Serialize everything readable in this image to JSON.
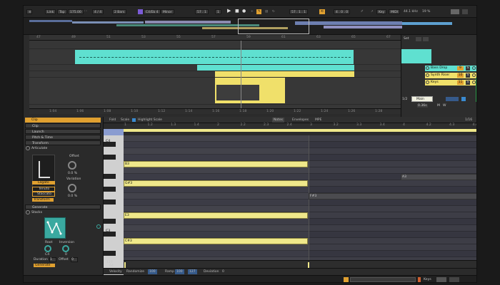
{
  "transport": {
    "link": "Link",
    "tap": "Tap",
    "tempo": "175.00",
    "signature": "4 / 4",
    "quantize": "2 Bars",
    "key": "C4/Eb 4",
    "scale": "Minor",
    "position": "57 . 1",
    "position2": "1",
    "loop_start": "57 . 1 . 1",
    "loop_len": "4 . 0 . 0",
    "key_label": "Key",
    "midi_label": "MIDI",
    "sample_rate": "44.1 kHz",
    "cpu": "19 %"
  },
  "ruler_top": [
    "47",
    "49",
    "51",
    "53",
    "55",
    "57",
    "59",
    "61",
    "63",
    "65",
    "67"
  ],
  "ruler_bottom": [
    "1:04",
    "1:06",
    "1:08",
    "1:10",
    "1:12",
    "1:14",
    "1:16",
    "1:18",
    "1:20",
    "1:22",
    "1:24",
    "1:26",
    "1:28",
    "1:30"
  ],
  "tracks": [
    {
      "name": "Bass Drop",
      "num": "9",
      "s": "S",
      "color": "#5fe0d0"
    },
    {
      "name": "Synth Riser",
      "num": "10",
      "s": "S",
      "color": "#f0e06a"
    },
    {
      "name": "Keys",
      "num": "11",
      "s": "S",
      "color": "#f0e06a"
    }
  ],
  "right_panel": {
    "set_label": "Set",
    "page_counter": "1/2",
    "main": "Main",
    "vol": "-inf",
    "send_a": "A",
    "zoom": "0.36s",
    "m": "M",
    "w": "W"
  },
  "device": {
    "clip": "Clip",
    "clip2": "Clip",
    "launch": "Launch",
    "pitch_time": "Pitch & Time",
    "transform": "Transform",
    "articulate": "Articulate",
    "offset_label": "Offset",
    "offset_value": "0.0 %",
    "variation_label": "Variation",
    "variation_value": "0.0 %",
    "legato": "Legato",
    "tenuto": "Tenuto",
    "staccato": "Staccato",
    "transform_btn": "Transform",
    "generate": "Generate",
    "stacks": "Stacks",
    "root_label": "Root",
    "root_value": "C4",
    "inversion_label": "Inversion",
    "inversion_value": "0",
    "duration_label": "Duration",
    "duration_value": "1",
    "offset2_label": "Offset",
    "offset2_value": "0",
    "generate_btn": "Generate"
  },
  "piano_head": {
    "fold": "Fold",
    "scale": "Scale",
    "highlight": "Highlight Scale",
    "notes_tab": "Notes",
    "envelopes_tab": "Envelopes",
    "mpe_tab": "MPE",
    "grid": "1/16"
  },
  "beat_ruler": [
    "1",
    "1.2",
    "1.3",
    "1.4",
    "2",
    "2.2",
    "2.3",
    "2.4",
    "3",
    "3.2",
    "3.3",
    "3.4",
    "4",
    "4.2",
    "4.3",
    "4.4"
  ],
  "key_labels": {
    "top": "C4",
    "bottom": "C3"
  },
  "notes": [
    {
      "label": "B3",
      "row": 5
    },
    {
      "label": "G#3",
      "row": 8
    },
    {
      "label": "E3",
      "row": 13
    },
    {
      "label": "C#3",
      "row": 17
    }
  ],
  "grey_notes": [
    {
      "label": "F#3",
      "row": 10
    },
    {
      "label": "A3",
      "row": 7
    }
  ],
  "velocity": {
    "v1": "127",
    "v2": "64",
    "v3": "1"
  },
  "footer": {
    "velocity": "Velocity",
    "randomize": "Randomize",
    "rand_val": "100",
    "ramp": "Ramp",
    "ramp_val1": "100",
    "ramp_val2": "127",
    "deviation": "Deviation",
    "dev_val": "0"
  },
  "status": {
    "keys_label": "Keys"
  }
}
